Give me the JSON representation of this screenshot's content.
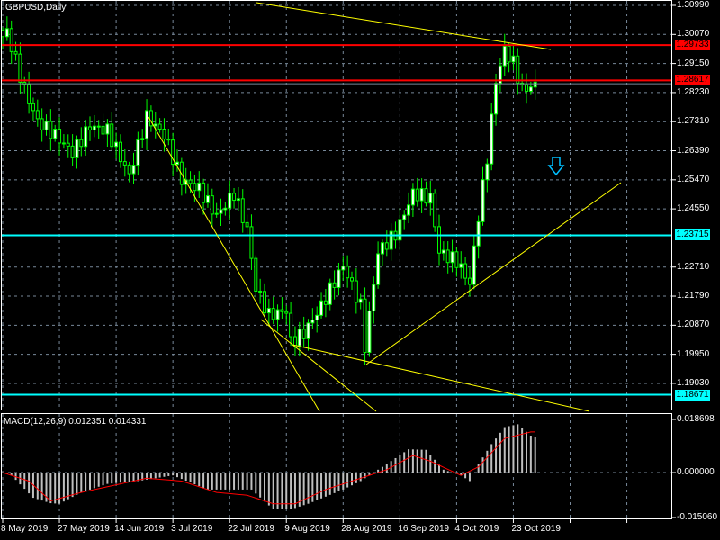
{
  "window": {
    "title": "GBPUSD,Daily"
  },
  "price_axis": {
    "ticks": [
      "1.30990",
      "1.30070",
      "1.29150",
      "1.28230",
      "1.27310",
      "1.26390",
      "1.25470",
      "1.24550",
      "1.22710",
      "1.21790",
      "1.20870",
      "1.19950",
      "1.19030"
    ],
    "range": [
      1.185,
      1.312
    ]
  },
  "price_levels": [
    {
      "label": "1.29733",
      "value": 1.29733,
      "color": "#ff0000",
      "text_color": "#000000"
    },
    {
      "label": "1.28617",
      "value": 1.28617,
      "color": "#ff0000",
      "text_color": "#000000"
    },
    {
      "label": "1.23715",
      "value": 1.23715,
      "color": "#00ffff",
      "text_color": "#000000"
    },
    {
      "label": "1.18671",
      "value": 1.18671,
      "color": "#00ffff",
      "text_color": "#000000"
    }
  ],
  "bid_line": 1.2851,
  "macd": {
    "label": "MACD(12,26,9) 0.012351 0.014331",
    "ticks": [
      "0.018698",
      "0.000000",
      "-0.015060"
    ],
    "range": [
      -0.01506,
      0.018698
    ]
  },
  "time_axis": [
    {
      "label": "8 May 2019",
      "bar": 0
    },
    {
      "label": "27 May 2019",
      "bar": 13
    },
    {
      "label": "14 Jun 2019",
      "bar": 26
    },
    {
      "label": "3 Jul 2019",
      "bar": 39
    },
    {
      "label": "22 Jul 2019",
      "bar": 52
    },
    {
      "label": "9 Aug 2019",
      "bar": 65
    },
    {
      "label": "28 Aug 2019",
      "bar": 78
    },
    {
      "label": "16 Sep 2019",
      "bar": 91
    },
    {
      "label": "4 Oct 2019",
      "bar": 104
    },
    {
      "label": "23 Oct 2019",
      "bar": 117
    }
  ],
  "chart_data": {
    "type": "candlestick",
    "symbol": "GBPUSD",
    "timeframe": "Daily",
    "bars": 123,
    "close_anchors": [
      [
        0,
        1.3
      ],
      [
        1,
        1.3016
      ],
      [
        5,
        1.2831
      ],
      [
        8,
        1.2732
      ],
      [
        12,
        1.2689
      ],
      [
        16,
        1.2632
      ],
      [
        20,
        1.2717
      ],
      [
        24,
        1.2703
      ],
      [
        29,
        1.2561
      ],
      [
        33,
        1.2746
      ],
      [
        37,
        1.2689
      ],
      [
        41,
        1.2547
      ],
      [
        45,
        1.2518
      ],
      [
        49,
        1.2433
      ],
      [
        53,
        1.2504
      ],
      [
        56,
        1.239
      ],
      [
        58,
        1.2205
      ],
      [
        61,
        1.2119
      ],
      [
        65,
        1.2134
      ],
      [
        66,
        1.2034
      ],
      [
        69,
        1.2062
      ],
      [
        73,
        1.2148
      ],
      [
        78,
        1.2276
      ],
      [
        82,
        1.2148
      ],
      [
        83,
        1.202
      ],
      [
        86,
        1.2319
      ],
      [
        90,
        1.2376
      ],
      [
        94,
        1.2504
      ],
      [
        98,
        1.249
      ],
      [
        100,
        1.2319
      ],
      [
        104,
        1.229
      ],
      [
        107,
        1.2219
      ],
      [
        109,
        1.2433
      ],
      [
        111,
        1.2618
      ],
      [
        113,
        1.286
      ],
      [
        115,
        1.2959
      ],
      [
        117,
        1.2917
      ],
      [
        119,
        1.2831
      ],
      [
        122,
        1.2846
      ]
    ],
    "macd_hist_anchors": [
      [
        0,
        0
      ],
      [
        2,
        -0.001
      ],
      [
        7,
        -0.0089
      ],
      [
        11,
        -0.0108
      ],
      [
        13,
        -0.011
      ],
      [
        18,
        -0.007
      ],
      [
        24,
        -0.004
      ],
      [
        31,
        -0.003
      ],
      [
        39,
        -0.001
      ],
      [
        47,
        -0.006
      ],
      [
        57,
        -0.006
      ],
      [
        62,
        -0.013
      ],
      [
        66,
        -0.013
      ],
      [
        70,
        -0.011
      ],
      [
        78,
        -0.006
      ],
      [
        82,
        -0.003
      ],
      [
        88,
        0.003
      ],
      [
        93,
        0.0082
      ],
      [
        97,
        0.008
      ],
      [
        101,
        0.001
      ],
      [
        105,
        -0.001
      ],
      [
        107,
        -0.003
      ],
      [
        109,
        0.003
      ],
      [
        112,
        0.01
      ],
      [
        115,
        0.016
      ],
      [
        118,
        0.017
      ],
      [
        121,
        0.013
      ],
      [
        122,
        0.0124
      ]
    ],
    "macd_signal_anchors": [
      [
        0,
        0
      ],
      [
        6,
        -0.003
      ],
      [
        11,
        -0.01
      ],
      [
        18,
        -0.007
      ],
      [
        27,
        -0.004
      ],
      [
        33,
        -0.002
      ],
      [
        41,
        -0.003
      ],
      [
        49,
        -0.007
      ],
      [
        56,
        -0.008
      ],
      [
        62,
        -0.011
      ],
      [
        67,
        -0.011
      ],
      [
        74,
        -0.006
      ],
      [
        82,
        -0.002
      ],
      [
        88,
        0.001
      ],
      [
        94,
        0.006
      ],
      [
        98,
        0.004
      ],
      [
        105,
        -0.001
      ],
      [
        109,
        0.002
      ],
      [
        115,
        0.012
      ],
      [
        121,
        0.0143
      ],
      [
        122,
        0.0143
      ]
    ]
  }
}
